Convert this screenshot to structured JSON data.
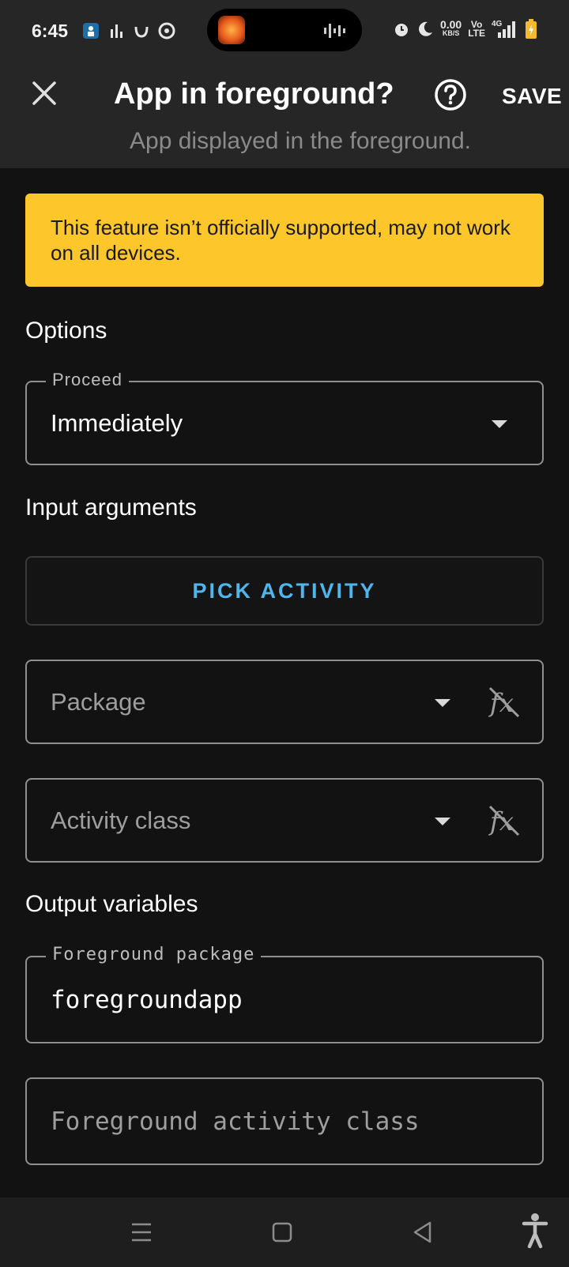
{
  "status_bar": {
    "time": "6:45",
    "net_speed_value": "0.00",
    "net_speed_unit": "KB/S",
    "volte_top": "Vo",
    "volte_bottom": "LTE",
    "network_type": "4G"
  },
  "app_bar": {
    "title": "App in foreground?",
    "subtitle": "App displayed in the foreground.",
    "save_label": "SAVE"
  },
  "warning": {
    "text": "This feature isn’t officially supported, may not work on all devices."
  },
  "options": {
    "heading": "Options",
    "proceed": {
      "label": "Proceed",
      "value": "Immediately"
    }
  },
  "input_arguments": {
    "heading": "Input arguments",
    "pick_activity_label": "PICK ACTIVITY",
    "package_placeholder": "Package",
    "activity_class_placeholder": "Activity class"
  },
  "output_variables": {
    "heading": "Output variables",
    "foreground_package": {
      "label": "Foreground package",
      "value": "foregroundapp"
    },
    "foreground_activity_class_placeholder": "Foreground activity class"
  },
  "colors": {
    "warning_bg": "#fdc62b",
    "accent_link": "#4fb6ec",
    "app_bar_bg": "#262626",
    "page_bg": "#121212"
  },
  "icons": [
    "close-icon",
    "help-icon",
    "dropdown-arrow-icon",
    "fx-disabled-icon",
    "menu-icon",
    "home-icon",
    "back-icon",
    "accessibility-icon"
  ]
}
